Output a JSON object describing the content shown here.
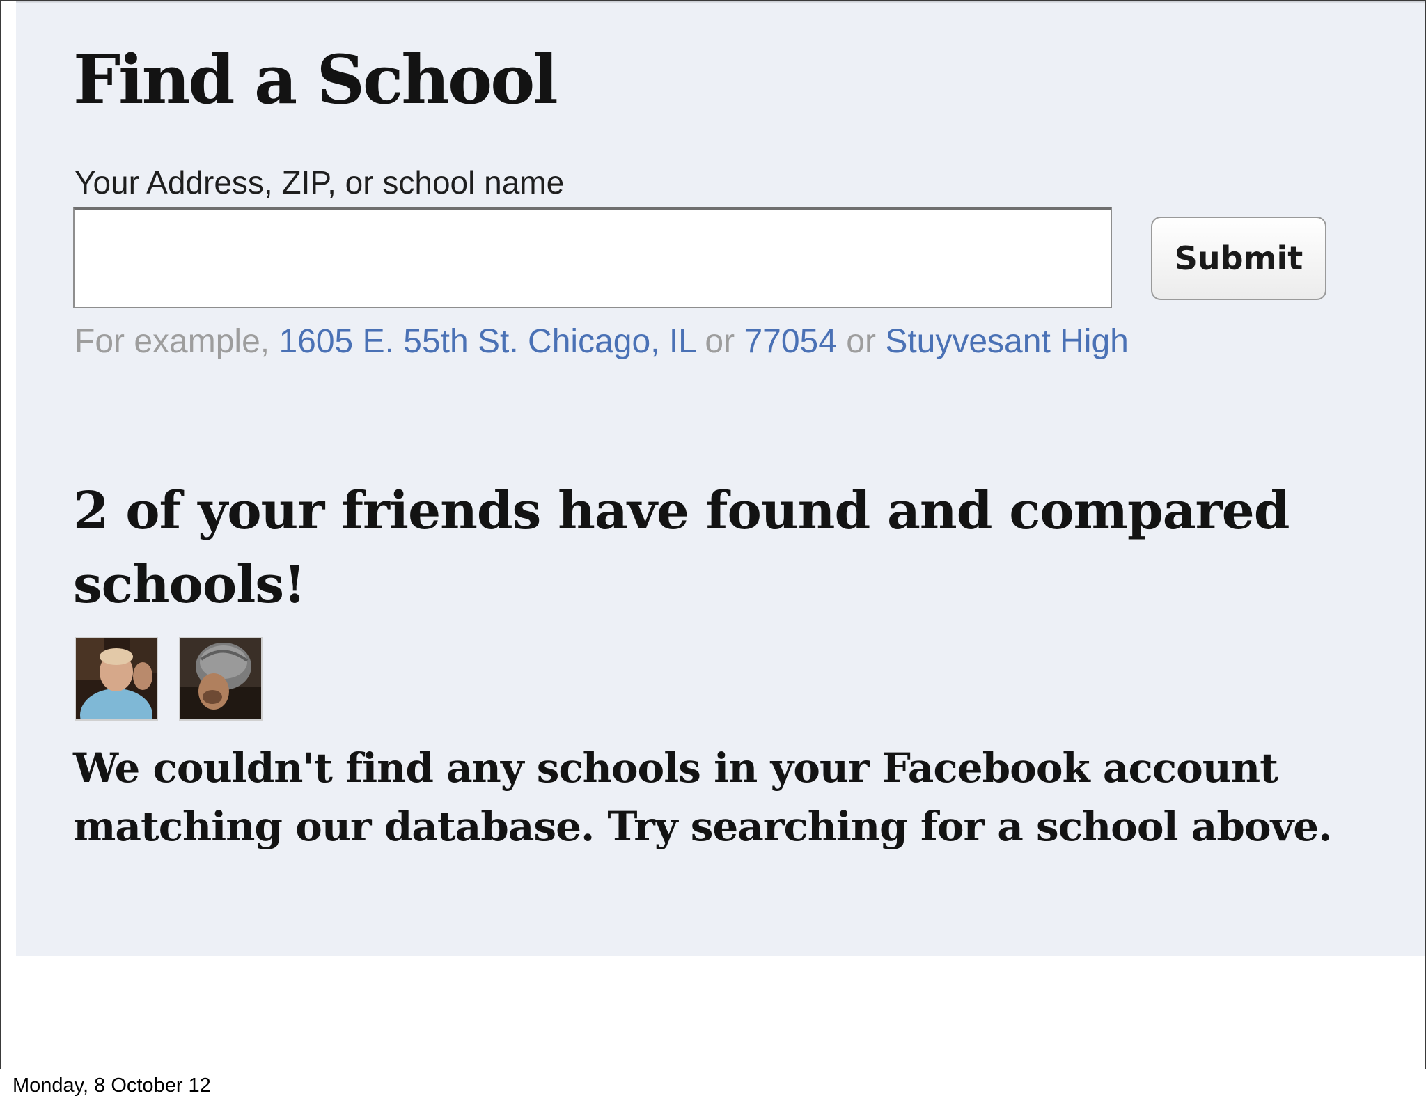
{
  "page": {
    "title": "Find a School"
  },
  "search": {
    "label": "Your Address, ZIP, or school name",
    "value": "",
    "placeholder": "",
    "submit_label": "Submit"
  },
  "examples": {
    "prefix": "For example,",
    "separator": "or",
    "links": [
      "1605 E. 55th St. Chicago, IL",
      "77054",
      "Stuyvesant High"
    ]
  },
  "friends": {
    "heading": "2 of your friends have found and compared schools!",
    "avatars": [
      "friend-avatar-1",
      "friend-avatar-2"
    ]
  },
  "message": "We couldn't find any schools in your Facebook account matching our database. Try searching for a school above.",
  "footer": {
    "date": "Monday, 8 October 12"
  },
  "colors": {
    "panel_background": "#edf0f6",
    "link": "#4a71b5",
    "hint_text": "#9d9d9d"
  }
}
